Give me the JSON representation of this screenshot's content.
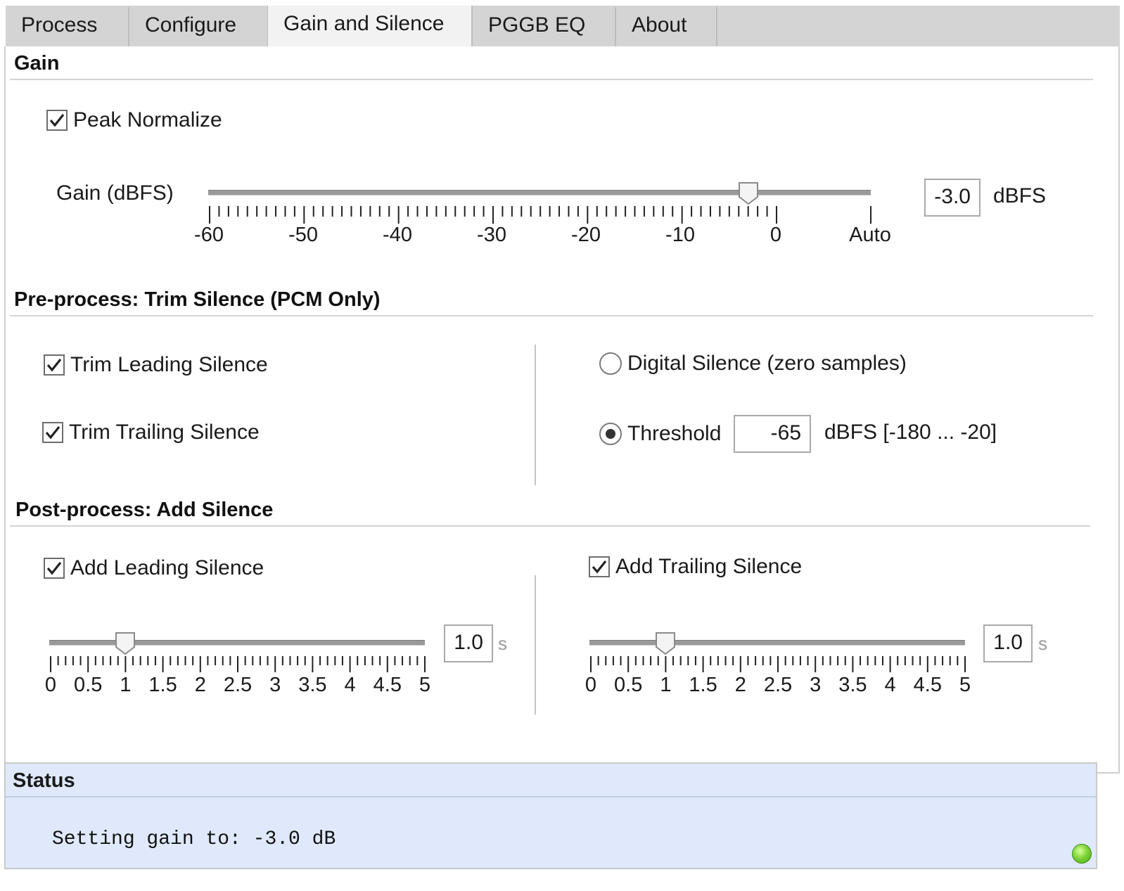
{
  "tabs": [
    {
      "label": "Process",
      "active": false
    },
    {
      "label": "Configure",
      "active": false
    },
    {
      "label": "Gain and Silence",
      "active": true
    },
    {
      "label": "PGGB EQ",
      "active": false
    },
    {
      "label": "About",
      "active": false
    }
  ],
  "gain": {
    "heading": "Gain",
    "peak_normalize_label": "Peak Normalize",
    "peak_normalize_checked": true,
    "slider_label": "Gain (dBFS)",
    "value": "-3.0",
    "unit": "dBFS",
    "tick_labels": [
      "-60",
      "-50",
      "-40",
      "-30",
      "-20",
      "-10",
      "0",
      "Auto"
    ],
    "slider_value": -3.0
  },
  "trim": {
    "heading": "Pre-process: Trim Silence (PCM Only)",
    "leading_label": "Trim Leading Silence",
    "leading_checked": true,
    "trailing_label": "Trim Trailing Silence",
    "trailing_checked": true,
    "digital_label": "Digital Silence (zero samples)",
    "digital_selected": false,
    "threshold_label": "Threshold",
    "threshold_selected": true,
    "threshold_value": "-65",
    "threshold_range": "dBFS [-180 ... -20]"
  },
  "add": {
    "heading": "Post-process: Add Silence",
    "leading_label": "Add Leading Silence",
    "leading_checked": true,
    "leading_value": "1.0",
    "leading_unit": "s",
    "trailing_label": "Add Trailing Silence",
    "trailing_checked": true,
    "trailing_value": "1.0",
    "trailing_unit": "s",
    "tick_labels": [
      "0",
      "0.5",
      "1",
      "1.5",
      "2",
      "2.5",
      "3",
      "3.5",
      "4",
      "4.5",
      "5"
    ],
    "leading_slider_value": 1.0,
    "trailing_slider_value": 1.0
  },
  "status": {
    "title": "Status",
    "message": "Setting gain to: -3.0 dB",
    "indicator_color": "#6cc832"
  }
}
